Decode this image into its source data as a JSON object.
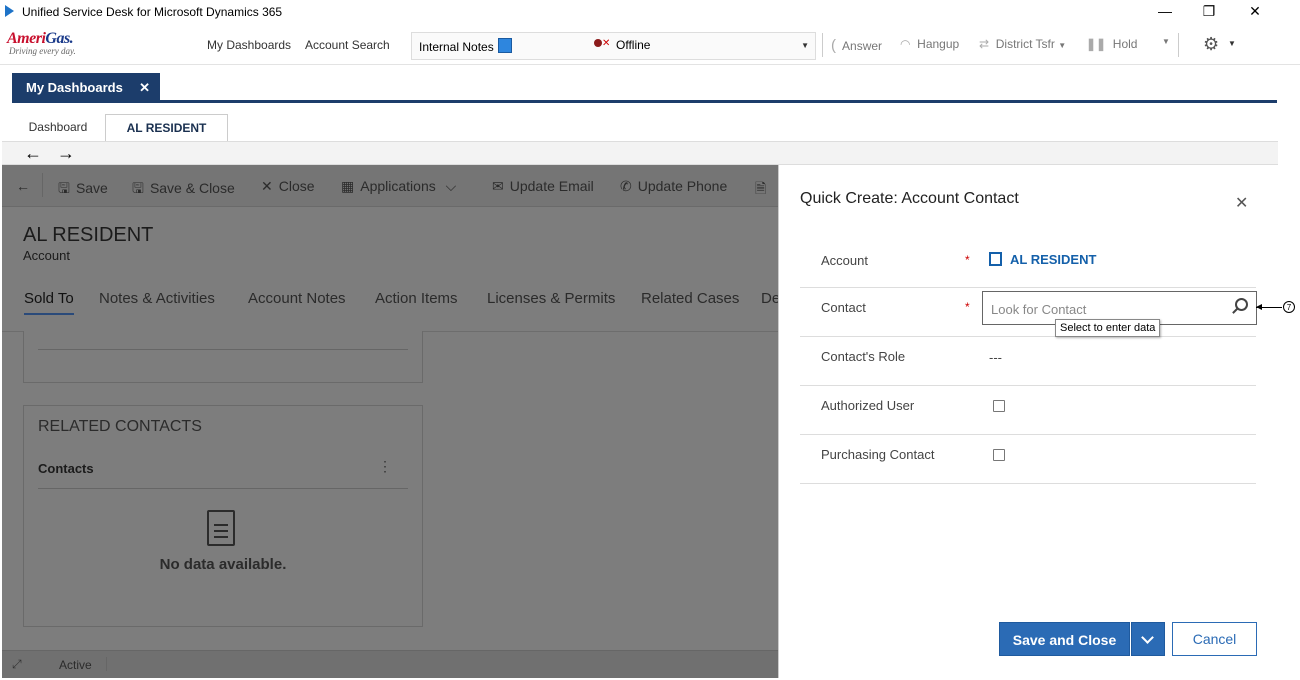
{
  "window": {
    "title": "Unified Service Desk for Microsoft Dynamics 365",
    "minimize": "—",
    "restore": "❐",
    "close": "✕"
  },
  "logo": {
    "brand_a": "Ameri",
    "brand_b": "Gas.",
    "tagline": "Driving every day."
  },
  "toolbar": {
    "links": [
      "My Dashboards",
      "Account Search"
    ],
    "notes_label": "Internal Notes",
    "presence": "Offline",
    "answer": "Answer",
    "hangup": "Hangup",
    "transfer": "District Tsfr",
    "hold": "Hold",
    "settings_icon": "gear-icon"
  },
  "session_tab": {
    "label": "My Dashboards",
    "close": "✕"
  },
  "subtabs": [
    "Dashboard",
    "AL RESIDENT"
  ],
  "nav": {
    "back": "←",
    "forward": "→"
  },
  "command_bar": {
    "items": [
      "Save",
      "Save & Close",
      "Close",
      "Applications",
      "Update Email",
      "Update Phone"
    ]
  },
  "record": {
    "title": "AL RESIDENT",
    "entity": "Account",
    "tabs": [
      "Sold To",
      "Notes & Activities",
      "Account Notes",
      "Action Items",
      "Licenses & Permits",
      "Related Cases",
      "De"
    ]
  },
  "related": {
    "heading": "RELATED CONTACTS",
    "subgrid": "Contacts",
    "more": "⋮",
    "empty": "No data available."
  },
  "status": {
    "text": "Active"
  },
  "quick_create": {
    "title": "Quick Create: Account Contact",
    "close": "✕",
    "fields": {
      "account_label": "Account",
      "account_value": "AL RESIDENT",
      "contact_label": "Contact",
      "contact_placeholder": "Look for Contact",
      "tooltip": "Select to enter data",
      "role_label": "Contact's Role",
      "role_value": "---",
      "authorized_label": "Authorized User",
      "authorized_checked": false,
      "purchasing_label": "Purchasing Contact",
      "purchasing_checked": false
    },
    "required_mark": "*",
    "save_button": "Save and Close",
    "cancel_button": "Cancel"
  },
  "annotation": {
    "number": "7"
  }
}
